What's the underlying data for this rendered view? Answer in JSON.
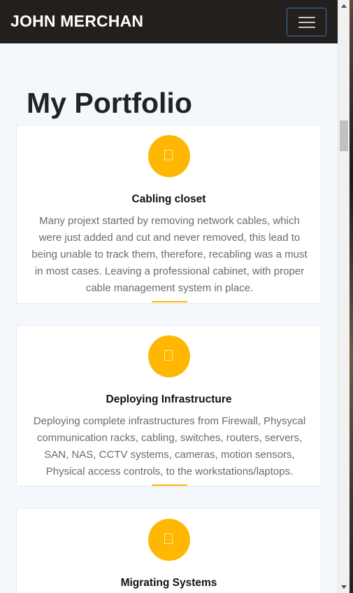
{
  "navbar": {
    "brand": "JOHN MERCHAN",
    "toggle_icon": "hamburger-icon"
  },
  "portfolio": {
    "title": "My Portfolio",
    "items": [
      {
        "icon": "placeholder-glyph-icon",
        "title": "Cabling closet",
        "text": "Many projext started by removing network cables, which were just added and cut and never removed, this lead to being unable to track them, therefore, recabling was a must in most cases. Leaving a professional cabinet, with proper cable management system in place."
      },
      {
        "icon": "placeholder-glyph-icon",
        "title": "Deploying Infrastructure",
        "text": "Deploying complete infrastructures from Firewall, Physycal communication racks, cabling, switches, routers, servers, SAN, NAS, CCTV systems, cameras, motion sensors, Physical access controls, to the workstations/laptops."
      },
      {
        "icon": "placeholder-glyph-icon",
        "title": "Migrating Systems",
        "text": ""
      }
    ]
  },
  "colors": {
    "navbar_bg": "#231f1d",
    "accent": "#ffb703",
    "page_bg": "#f4f7fb"
  }
}
